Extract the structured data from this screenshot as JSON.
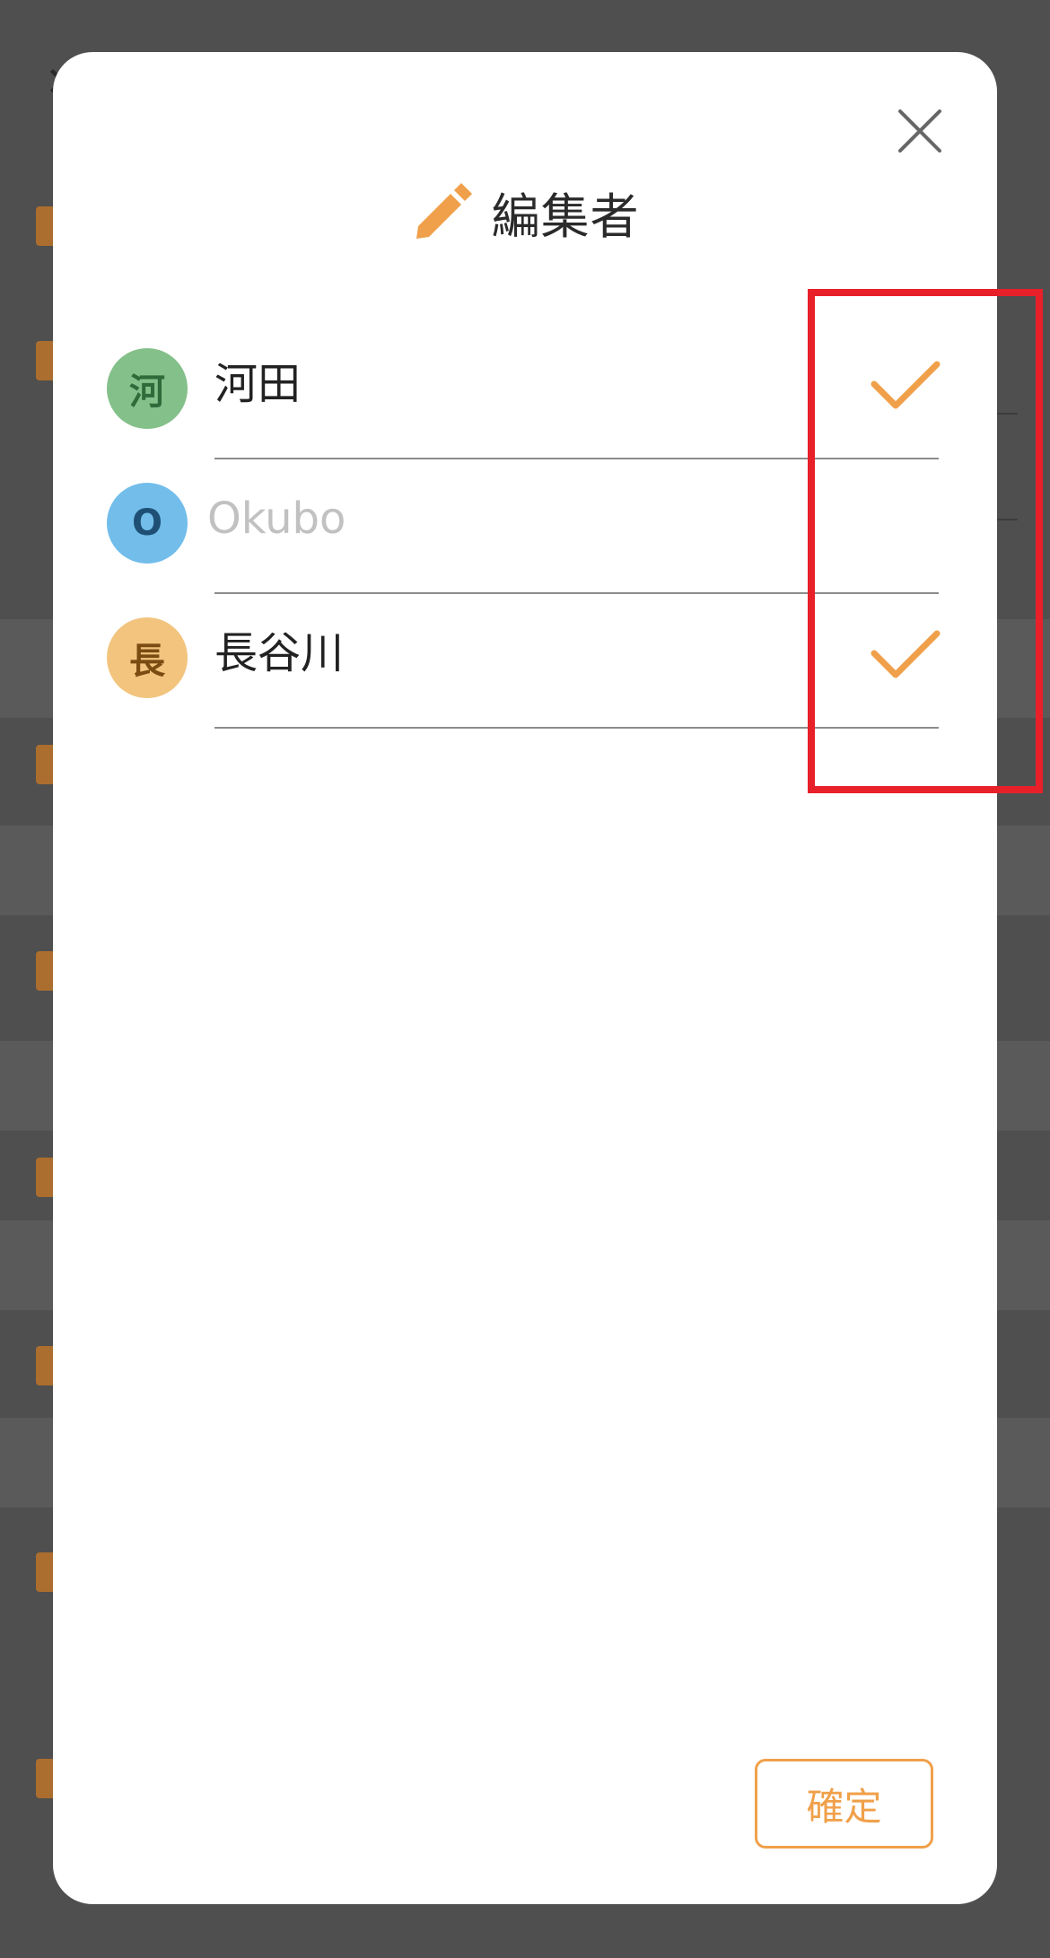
{
  "modal": {
    "title": "編集者",
    "confirm_label": "確定"
  },
  "editors": [
    {
      "initial": "河",
      "name": "河田",
      "selected": true,
      "avatar_bg": "#84c08a",
      "avatar_fg": "#2f6b3a"
    },
    {
      "initial": "O",
      "name": "Okubo",
      "selected": false,
      "avatar_bg": "#72bdea",
      "avatar_fg": "#1e4f74"
    },
    {
      "initial": "長",
      "name": "長谷川",
      "selected": true,
      "avatar_bg": "#f2c47e",
      "avatar_fg": "#7a4c12"
    }
  ],
  "icons": {
    "title": "pencil-icon",
    "close": "close-icon",
    "selected": "checkmark-icon"
  },
  "colors": {
    "accent": "#f0a04a",
    "highlight": "#e8202a",
    "overlay": "#4f4f4f"
  }
}
